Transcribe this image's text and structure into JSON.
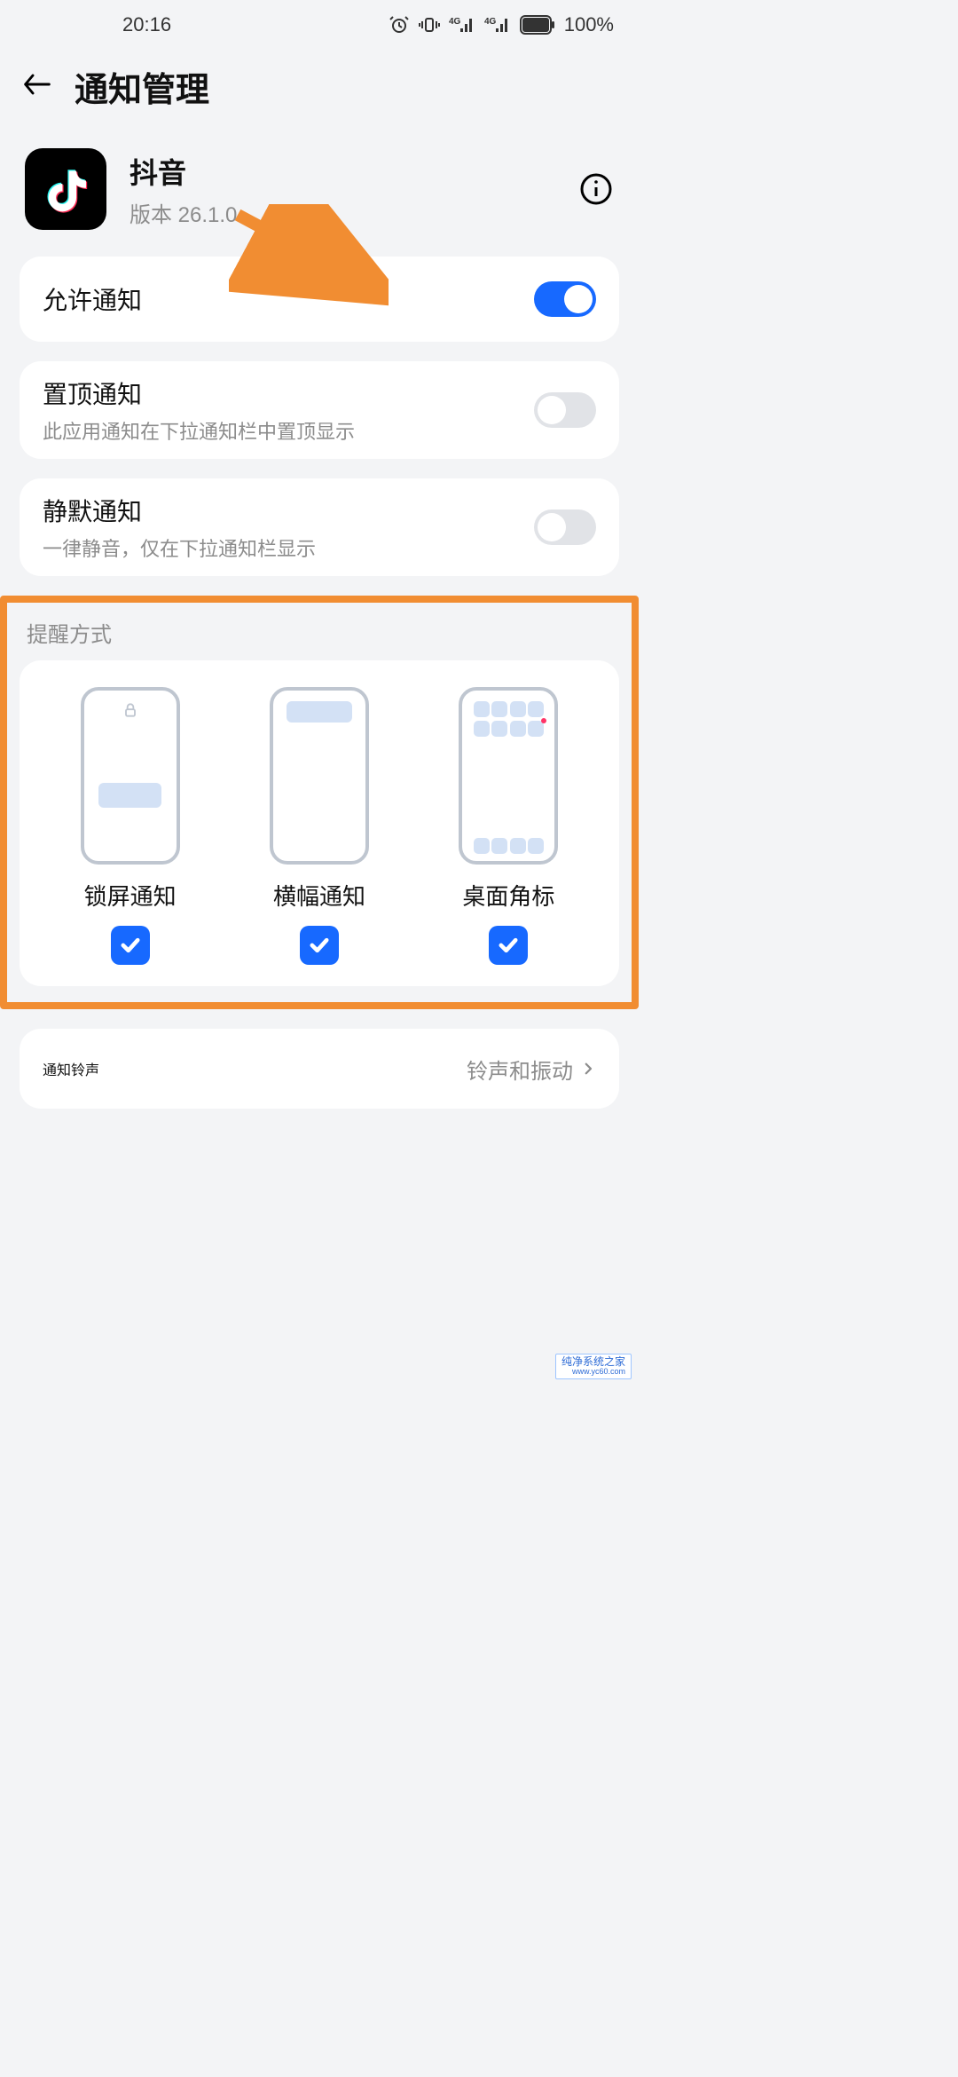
{
  "statusbar": {
    "time": "20:16",
    "battery_text": "100%"
  },
  "header": {
    "title": "通知管理"
  },
  "app": {
    "name": "抖音",
    "version_label": "版本 26.1.0"
  },
  "toggles": {
    "allow": {
      "label": "允许通知"
    },
    "pin": {
      "label": "置顶通知",
      "sub": "此应用通知在下拉通知栏中置顶显示"
    },
    "silent": {
      "label": "静默通知",
      "sub": "一律静音，仅在下拉通知栏显示"
    }
  },
  "reminder": {
    "section_title": "提醒方式",
    "items": {
      "lock": {
        "label": "锁屏通知"
      },
      "banner": {
        "label": "横幅通知"
      },
      "badge": {
        "label": "桌面角标"
      }
    }
  },
  "ringtone": {
    "label": "通知铃声",
    "value": "铃声和振动"
  },
  "watermark": {
    "main": "纯净系统之家",
    "sub": "www.yc60.com"
  }
}
